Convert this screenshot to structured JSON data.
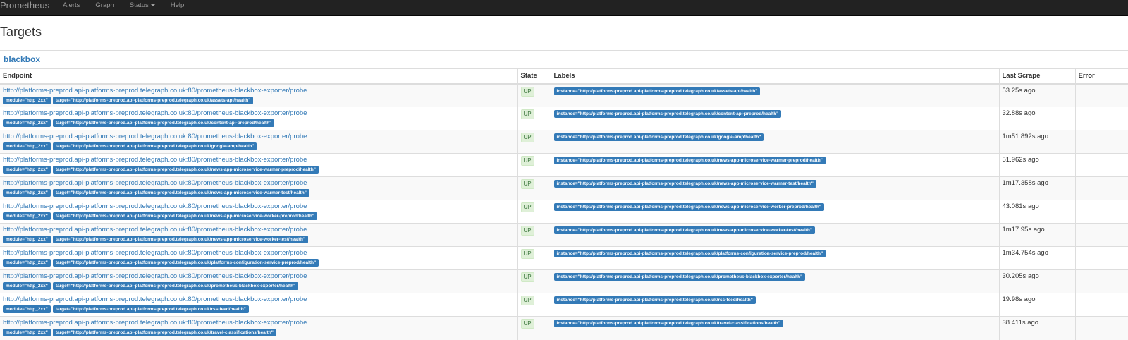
{
  "nav": {
    "brand": "Prometheus",
    "items": [
      "Alerts",
      "Graph",
      "Status",
      "Help"
    ]
  },
  "page_title": "Targets",
  "job": "blackbox",
  "columns": [
    "Endpoint",
    "State",
    "Labels",
    "Last Scrape",
    "Error"
  ],
  "colors": {
    "navbar": "#222222",
    "link": "#337ab7",
    "up_bg": "#dff0d8",
    "up_text": "#3c763d"
  },
  "rows": [
    {
      "endpoint": "http://platforms-preprod.api-platforms-preprod.telegraph.co.uk:80/prometheus-blackbox-exporter/probe",
      "module": "module=\"http_2xx\"",
      "target": "target=\"http://platforms-preprod.api-platforms-preprod.telegraph.co.uk/assets-api/health\"",
      "state": "UP",
      "instance": "instance=\"http://platforms-preprod.api-platforms-preprod.telegraph.co.uk/assets-api/health\"",
      "last_scrape": "53.25s ago",
      "error": ""
    },
    {
      "endpoint": "http://platforms-preprod.api-platforms-preprod.telegraph.co.uk:80/prometheus-blackbox-exporter/probe",
      "module": "module=\"http_2xx\"",
      "target": "target=\"http://platforms-preprod.api-platforms-preprod.telegraph.co.uk/content-api-preprod/health\"",
      "state": "UP",
      "instance": "instance=\"http://platforms-preprod.api-platforms-preprod.telegraph.co.uk/content-api-preprod/health\"",
      "last_scrape": "32.88s ago",
      "error": ""
    },
    {
      "endpoint": "http://platforms-preprod.api-platforms-preprod.telegraph.co.uk:80/prometheus-blackbox-exporter/probe",
      "module": "module=\"http_2xx\"",
      "target": "target=\"http://platforms-preprod.api-platforms-preprod.telegraph.co.uk/google-amp/health\"",
      "state": "UP",
      "instance": "instance=\"http://platforms-preprod.api-platforms-preprod.telegraph.co.uk/google-amp/health\"",
      "last_scrape": "1m51.892s ago",
      "error": ""
    },
    {
      "endpoint": "http://platforms-preprod.api-platforms-preprod.telegraph.co.uk:80/prometheus-blackbox-exporter/probe",
      "module": "module=\"http_2xx\"",
      "target": "target=\"http://platforms-preprod.api-platforms-preprod.telegraph.co.uk/news-app-microservice-warmer-preprod/health\"",
      "state": "UP",
      "instance": "instance=\"http://platforms-preprod.api-platforms-preprod.telegraph.co.uk/news-app-microservice-warmer-preprod/health\"",
      "last_scrape": "51.962s ago",
      "error": ""
    },
    {
      "endpoint": "http://platforms-preprod.api-platforms-preprod.telegraph.co.uk:80/prometheus-blackbox-exporter/probe",
      "module": "module=\"http_2xx\"",
      "target": "target=\"http://platforms-preprod.api-platforms-preprod.telegraph.co.uk/news-app-microservice-warmer-test/health\"",
      "state": "UP",
      "instance": "instance=\"http://platforms-preprod.api-platforms-preprod.telegraph.co.uk/news-app-microservice-warmer-test/health\"",
      "last_scrape": "1m17.358s ago",
      "error": ""
    },
    {
      "endpoint": "http://platforms-preprod.api-platforms-preprod.telegraph.co.uk:80/prometheus-blackbox-exporter/probe",
      "module": "module=\"http_2xx\"",
      "target": "target=\"http://platforms-preprod.api-platforms-preprod.telegraph.co.uk/news-app-microservice-worker-preprod/health\"",
      "state": "UP",
      "instance": "instance=\"http://platforms-preprod.api-platforms-preprod.telegraph.co.uk/news-app-microservice-worker-preprod/health\"",
      "last_scrape": "43.081s ago",
      "error": ""
    },
    {
      "endpoint": "http://platforms-preprod.api-platforms-preprod.telegraph.co.uk:80/prometheus-blackbox-exporter/probe",
      "module": "module=\"http_2xx\"",
      "target": "target=\"http://platforms-preprod.api-platforms-preprod.telegraph.co.uk/news-app-microservice-worker-test/health\"",
      "state": "UP",
      "instance": "instance=\"http://platforms-preprod.api-platforms-preprod.telegraph.co.uk/news-app-microservice-worker-test/health\"",
      "last_scrape": "1m17.95s ago",
      "error": ""
    },
    {
      "endpoint": "http://platforms-preprod.api-platforms-preprod.telegraph.co.uk:80/prometheus-blackbox-exporter/probe",
      "module": "module=\"http_2xx\"",
      "target": "target=\"http://platforms-preprod.api-platforms-preprod.telegraph.co.uk/platforms-configuration-service-preprod/health\"",
      "state": "UP",
      "instance": "instance=\"http://platforms-preprod.api-platforms-preprod.telegraph.co.uk/platforms-configuration-service-preprod/health\"",
      "last_scrape": "1m34.754s ago",
      "error": ""
    },
    {
      "endpoint": "http://platforms-preprod.api-platforms-preprod.telegraph.co.uk:80/prometheus-blackbox-exporter/probe",
      "module": "module=\"http_2xx\"",
      "target": "target=\"http://platforms-preprod.api-platforms-preprod.telegraph.co.uk/prometheus-blackbox-exporter/health\"",
      "state": "UP",
      "instance": "instance=\"http://platforms-preprod.api-platforms-preprod.telegraph.co.uk/prometheus-blackbox-exporter/health\"",
      "last_scrape": "30.205s ago",
      "error": ""
    },
    {
      "endpoint": "http://platforms-preprod.api-platforms-preprod.telegraph.co.uk:80/prometheus-blackbox-exporter/probe",
      "module": "module=\"http_2xx\"",
      "target": "target=\"http://platforms-preprod.api-platforms-preprod.telegraph.co.uk/rss-feed/health\"",
      "state": "UP",
      "instance": "instance=\"http://platforms-preprod.api-platforms-preprod.telegraph.co.uk/rss-feed/health\"",
      "last_scrape": "19.98s ago",
      "error": ""
    },
    {
      "endpoint": "http://platforms-preprod.api-platforms-preprod.telegraph.co.uk:80/prometheus-blackbox-exporter/probe",
      "module": "module=\"http_2xx\"",
      "target": "target=\"http://platforms-preprod.api-platforms-preprod.telegraph.co.uk/travel-classifications/health\"",
      "state": "UP",
      "instance": "instance=\"http://platforms-preprod.api-platforms-preprod.telegraph.co.uk/travel-classifications/health\"",
      "last_scrape": "38.411s ago",
      "error": ""
    }
  ]
}
